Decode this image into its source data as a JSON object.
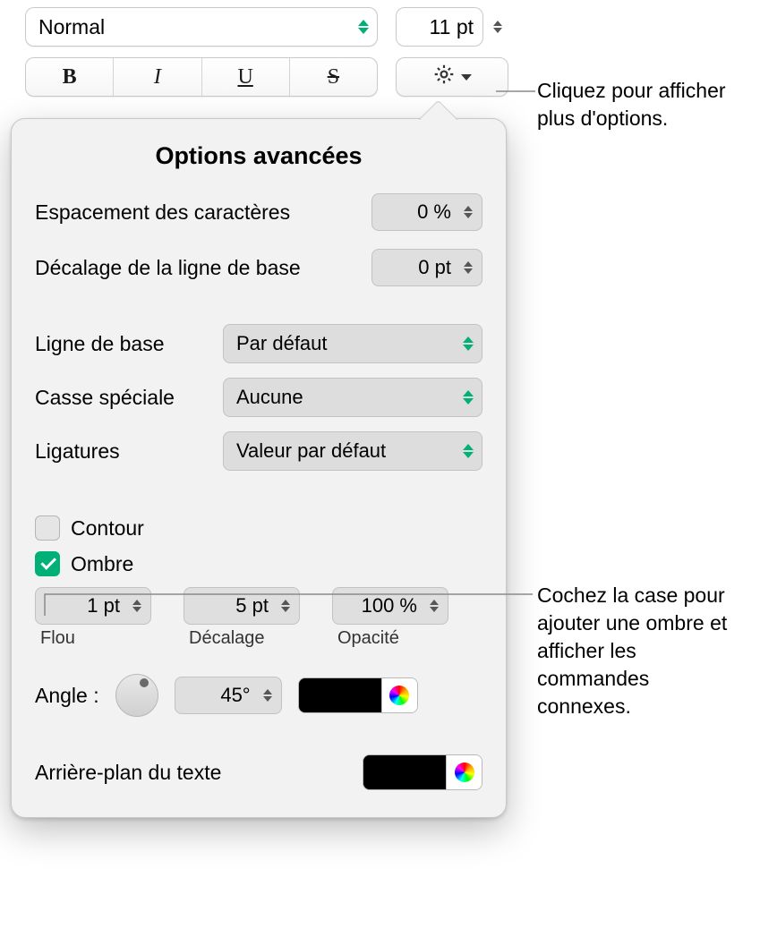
{
  "toolbar": {
    "style_popup": "Normal",
    "font_size": "11 pt",
    "bold_glyph": "B",
    "italic_glyph": "I",
    "underline_glyph": "U",
    "strike_glyph": "S"
  },
  "popover": {
    "title": "Options avancées",
    "char_spacing_label": "Espacement des caractères",
    "char_spacing_value": "0 %",
    "baseline_shift_label": "Décalage de la ligne de base",
    "baseline_shift_value": "0 pt",
    "baseline_label": "Ligne de base",
    "baseline_value": "Par défaut",
    "capitalization_label": "Casse spéciale",
    "capitalization_value": "Aucune",
    "ligatures_label": "Ligatures",
    "ligatures_value": "Valeur par défaut",
    "outline_label": "Contour",
    "outline_checked": false,
    "shadow_label": "Ombre",
    "shadow_checked": true,
    "shadow": {
      "blur_value": "1 pt",
      "blur_label": "Flou",
      "offset_value": "5 pt",
      "offset_label": "Décalage",
      "opacity_value": "100 %",
      "opacity_label": "Opacité",
      "angle_label": "Angle :",
      "angle_value": "45°",
      "color": "#000000"
    },
    "text_bg_label": "Arrière-plan du texte",
    "text_bg_color": "#000000"
  },
  "callouts": {
    "c1": "Cliquez pour afficher plus d'options.",
    "c2": "Cochez la case pour ajouter une ombre et afficher les commandes connexes."
  },
  "colors": {
    "accent": "#00b076"
  }
}
